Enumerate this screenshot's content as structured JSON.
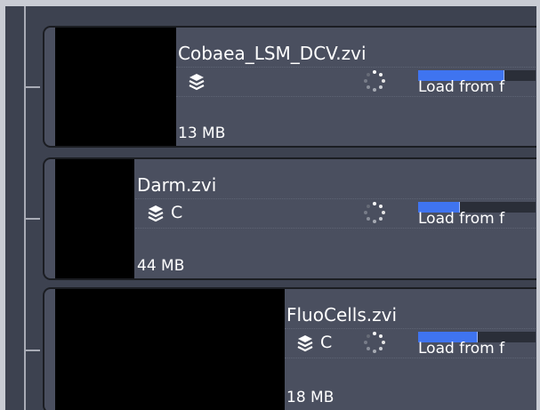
{
  "files": [
    {
      "name": "Cobaea_LSM_DCV.zvi",
      "channel": "",
      "size": "13 MB",
      "load_label": "Load from f",
      "progress": 0.73
    },
    {
      "name": "Darm.zvi",
      "channel": "C",
      "size": "44 MB",
      "load_label": "Load from f",
      "progress": 0.35
    },
    {
      "name": "FluoCells.zvi",
      "channel": "C",
      "size": "18 MB",
      "load_label": "Load from f",
      "progress": 0.5
    }
  ],
  "icons": {
    "stack": "layers-icon",
    "spinner": "loading-spinner-icon"
  },
  "colors": {
    "panel": "#3d4250",
    "item": "#4a4f5f",
    "thumbnail": "#000000",
    "progress": "#3f74f0"
  }
}
